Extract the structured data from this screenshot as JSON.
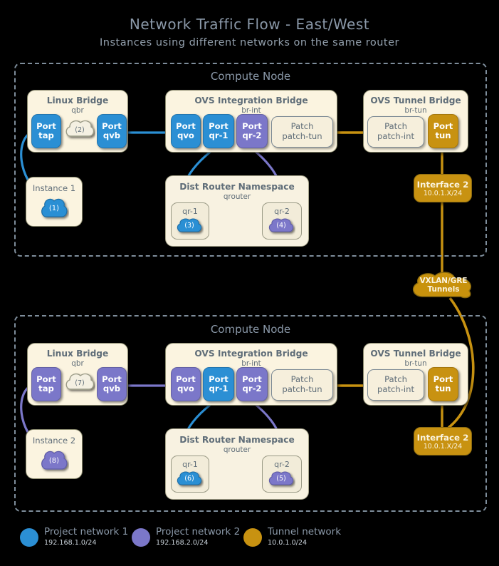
{
  "header": {
    "title": "Network Traffic Flow - East/West",
    "subtitle": "Instances using different networks on the same router"
  },
  "colors": {
    "project_network_1": "#2b8fd4",
    "project_network_2": "#7b77c9",
    "tunnel_network": "#c89211",
    "box_fill": "#fbf4e0",
    "box_border": "#8a8a6e",
    "text_slate": "#5f6d78",
    "dashed_border": "#7e8d9b",
    "background": "#000000"
  },
  "nodes": [
    {
      "id": "compute-node-top",
      "heading": "Compute Node",
      "linux_bridge": {
        "title": "Linux Bridge",
        "subtitle": "qbr",
        "ports": [
          {
            "label1": "Port",
            "label2": "tap",
            "color": "blue"
          },
          {
            "label1": "Port",
            "label2": "qvb",
            "color": "blue"
          }
        ],
        "cloud": "(2)"
      },
      "integration_bridge": {
        "title": "OVS Integration Bridge",
        "subtitle": "br-int",
        "ports": [
          {
            "label1": "Port",
            "label2": "qvo",
            "color": "blue"
          },
          {
            "label1": "Port",
            "label2": "qr-1",
            "color": "blue"
          },
          {
            "label1": "Port",
            "label2": "qr-2",
            "color": "purple"
          }
        ],
        "patch": {
          "label1": "Patch",
          "label2": "patch-tun"
        }
      },
      "tunnel_bridge": {
        "title": "OVS Tunnel Bridge",
        "subtitle": "br-tun",
        "patch": {
          "label1": "Patch",
          "label2": "patch-int"
        },
        "port": {
          "label1": "Port",
          "label2": "tun",
          "color": "gold"
        }
      },
      "instance": {
        "label": "Instance 1",
        "cloud": "(1)",
        "color": "blue"
      },
      "namespace": {
        "title": "Dist Router Namespace",
        "subtitle": "qrouter",
        "interfaces": [
          {
            "label": "qr-1",
            "cloud": "(3)",
            "color": "blue"
          },
          {
            "label": "qr-2",
            "cloud": "(4)",
            "color": "purple"
          }
        ]
      },
      "interface": {
        "name": "Interface 2",
        "cidr": "10.0.1.X/24"
      }
    },
    {
      "id": "compute-node-bottom",
      "heading": "Compute Node",
      "linux_bridge": {
        "title": "Linux Bridge",
        "subtitle": "qbr",
        "ports": [
          {
            "label1": "Port",
            "label2": "tap",
            "color": "purple"
          },
          {
            "label1": "Port",
            "label2": "qvb",
            "color": "purple"
          }
        ],
        "cloud": "(7)"
      },
      "integration_bridge": {
        "title": "OVS Integration Bridge",
        "subtitle": "br-int",
        "ports": [
          {
            "label1": "Port",
            "label2": "qvo",
            "color": "purple"
          },
          {
            "label1": "Port",
            "label2": "qr-1",
            "color": "blue"
          },
          {
            "label1": "Port",
            "label2": "qr-2",
            "color": "purple"
          }
        ],
        "patch": {
          "label1": "Patch",
          "label2": "patch-tun"
        }
      },
      "tunnel_bridge": {
        "title": "OVS Tunnel Bridge",
        "subtitle": "br-tun",
        "patch": {
          "label1": "Patch",
          "label2": "patch-int"
        },
        "port": {
          "label1": "Port",
          "label2": "tun",
          "color": "gold"
        }
      },
      "instance": {
        "label": "Instance 2",
        "cloud": "(8)",
        "color": "purple"
      },
      "namespace": {
        "title": "Dist Router Namespace",
        "subtitle": "qrouter",
        "interfaces": [
          {
            "label": "qr-1",
            "cloud": "(6)",
            "color": "blue"
          },
          {
            "label": "qr-2",
            "cloud": "(5)",
            "color": "purple"
          }
        ]
      },
      "interface": {
        "name": "Interface 2",
        "cidr": "10.0.1.X/24"
      }
    }
  ],
  "tunnel_cloud": {
    "line1": "VXLAN/GRE",
    "line2": "Tunnels"
  },
  "legend": [
    {
      "label": "Project network 1",
      "cidr": "192.168.1.0/24",
      "color": "#2b8fd4"
    },
    {
      "label": "Project network 2",
      "cidr": "192.168.2.0/24",
      "color": "#7b77c9"
    },
    {
      "label": "Tunnel network",
      "cidr": "10.0.1.0/24",
      "color": "#c89211"
    }
  ]
}
